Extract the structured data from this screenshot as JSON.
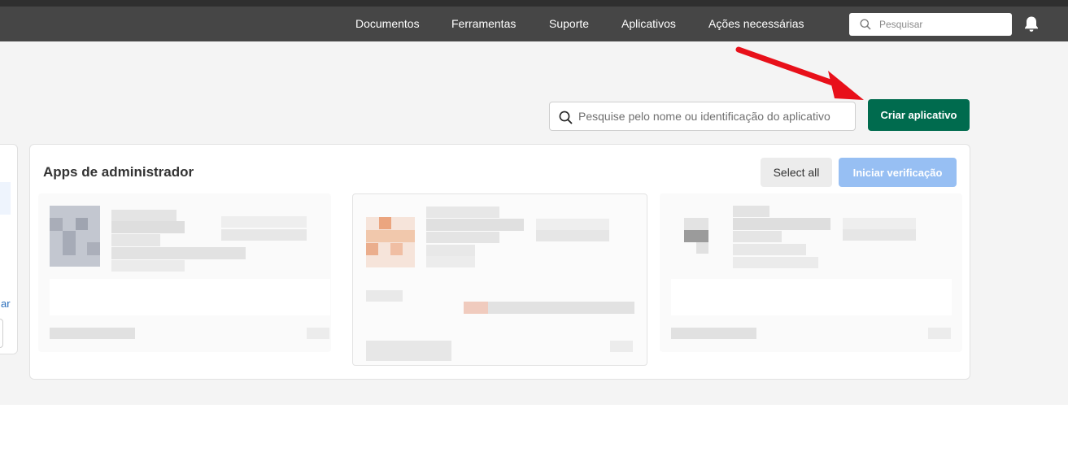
{
  "navbar": {
    "links": [
      "Documentos",
      "Ferramentas",
      "Suporte",
      "Aplicativos",
      "Ações necessárias"
    ],
    "search_placeholder": "Pesquisar",
    "notification_icon": "bell-icon",
    "search_icon": "search-icon"
  },
  "toolbar": {
    "search_placeholder": "Pesquise pelo nome ou identificação do aplicativo",
    "create_button": "Criar aplicativo",
    "accent_color": "#006b4e"
  },
  "sidebar": {
    "link_fragment": "ar"
  },
  "admin_apps": {
    "title": "Apps de administrador",
    "select_all": "Select all",
    "start_verification": "Iniciar verificação",
    "verify_color": "#97bff3",
    "cards_blurred": 3
  },
  "annotation": {
    "arrow_color": "#e8101a",
    "target": "create-app-button"
  }
}
